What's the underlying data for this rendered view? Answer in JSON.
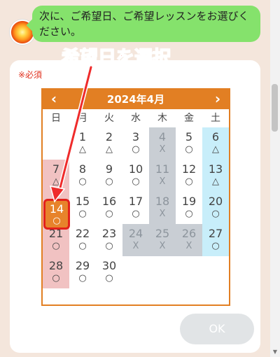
{
  "chat": {
    "message": "次に、ご希望日、ご希望レッスンをお選びください。"
  },
  "form": {
    "required_label": "※必須",
    "ok_label": "OK"
  },
  "calendar": {
    "title": "2024年4月",
    "prev_icon": "‹",
    "next_icon": "›",
    "weekdays": [
      "日",
      "月",
      "火",
      "水",
      "木",
      "金",
      "土"
    ],
    "weeks": [
      [
        {
          "day": "",
          "mark": ""
        },
        {
          "day": "1",
          "mark": "△"
        },
        {
          "day": "2",
          "mark": "△"
        },
        {
          "day": "3",
          "mark": "○"
        },
        {
          "day": "4",
          "mark": "X"
        },
        {
          "day": "5",
          "mark": "○"
        },
        {
          "day": "6",
          "mark": "△"
        }
      ],
      [
        {
          "day": "7",
          "mark": "△"
        },
        {
          "day": "8",
          "mark": "○"
        },
        {
          "day": "9",
          "mark": "○"
        },
        {
          "day": "10",
          "mark": "○"
        },
        {
          "day": "11",
          "mark": "X"
        },
        {
          "day": "12",
          "mark": "○"
        },
        {
          "day": "13",
          "mark": "△"
        }
      ],
      [
        {
          "day": "14",
          "mark": "○"
        },
        {
          "day": "15",
          "mark": "○"
        },
        {
          "day": "16",
          "mark": "○"
        },
        {
          "day": "17",
          "mark": "○"
        },
        {
          "day": "18",
          "mark": "X"
        },
        {
          "day": "19",
          "mark": "○"
        },
        {
          "day": "20",
          "mark": "○"
        }
      ],
      [
        {
          "day": "21",
          "mark": "○"
        },
        {
          "day": "22",
          "mark": "○"
        },
        {
          "day": "23",
          "mark": "○"
        },
        {
          "day": "24",
          "mark": "X"
        },
        {
          "day": "25",
          "mark": "X"
        },
        {
          "day": "26",
          "mark": "X"
        },
        {
          "day": "27",
          "mark": "○"
        }
      ],
      [
        {
          "day": "28",
          "mark": "○"
        },
        {
          "day": "29",
          "mark": "○"
        },
        {
          "day": "30",
          "mark": "○"
        },
        {
          "day": "",
          "mark": ""
        },
        {
          "day": "",
          "mark": ""
        },
        {
          "day": "",
          "mark": ""
        },
        {
          "day": "",
          "mark": ""
        }
      ]
    ],
    "selected": {
      "day": "14",
      "mark": "○"
    },
    "colors": {
      "header": "#e27f23",
      "selected_fill": "#e7832b",
      "selected_border": "#e3211b",
      "closed": "#c9ced4",
      "sunday": "#f1c2c2",
      "saturday": "#c8eefa"
    }
  },
  "annotation": {
    "label": "希望日を選択",
    "color": "#ef2b2b"
  }
}
